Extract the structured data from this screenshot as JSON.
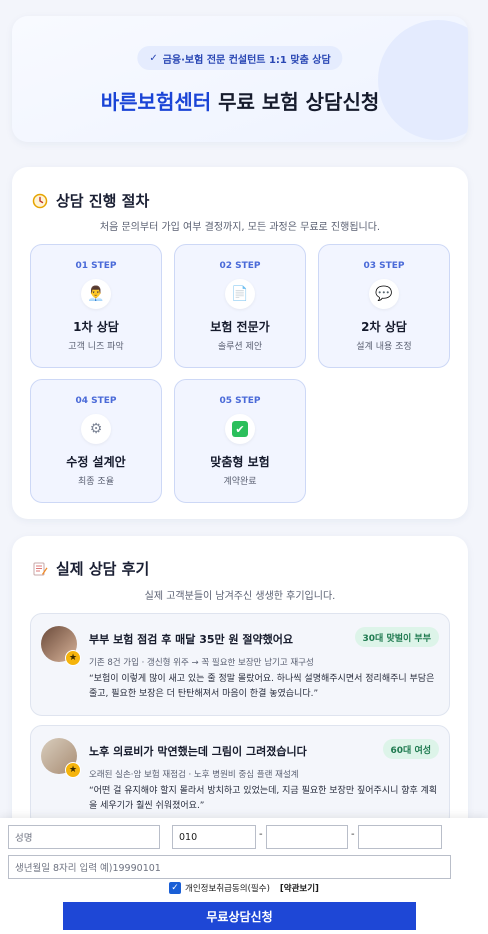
{
  "hero": {
    "badge_check": "✓",
    "badge": "금융·보험 전문 컨설턴트 1:1 맞춤 상담",
    "title_brand": "바른보험센터",
    "title_rest": " 무료 보험 상담신청"
  },
  "process": {
    "icon": "clock-icon",
    "title": "상담 진행 절차",
    "subtitle": "처음 문의부터 가입 여부 결정까지, 모든 과정은 무료로 진행됩니다.",
    "steps": [
      {
        "num": "01 STEP",
        "icon": "consultant-icon",
        "glyph": "👨‍💼",
        "name": "1차 상담",
        "desc": "고객 니즈 파악"
      },
      {
        "num": "02 STEP",
        "icon": "document-icon",
        "glyph": "📄",
        "name": "보험 전문가",
        "desc": "솔루션 제안"
      },
      {
        "num": "03 STEP",
        "icon": "speech-bubble-icon",
        "glyph": "💬",
        "name": "2차 상담",
        "desc": "설계 내용 조정"
      },
      {
        "num": "04 STEP",
        "icon": "gear-icon",
        "glyph": "⚙",
        "name": "수정 설계안",
        "desc": "최종 조율"
      },
      {
        "num": "05 STEP",
        "icon": "check-box-icon",
        "glyph": "✔",
        "name": "맞춤형 보험",
        "desc": "계약완료"
      }
    ]
  },
  "reviews": {
    "icon": "memo-icon",
    "title": "실제 상담 후기",
    "subtitle": "실제 고객분들이 남겨주신 생생한 후기입니다.",
    "items": [
      {
        "title": "부부 보험 점검 후 매달 35만 원 절약했어요",
        "tag": "30대 맞벌이 부부",
        "meta": "기존 8건 가입 · 갱신형 위주 → 꼭 필요한 보장만 남기고 재구성",
        "quote": "“보험이 이렇게 많이 새고 있는 줄 정말 몰랐어요. 하나씩 설명해주시면서 정리해주니 부담은 줄고, 필요한 보장은 더 탄탄해져서 마음이 한결 놓였습니다.”"
      },
      {
        "title": "노후 의료비가 막연했는데 그림이 그려졌습니다",
        "tag": "60대 여성",
        "meta": "오래된 실손·암 보험 재점검 · 노후 병원비 중심 플랜 재설계",
        "quote": "“어떤 걸 유지해야 할지 몰라서 방치하고 있었는데, 지금 필요한 보장만 짚어주시니 향후 계획을 세우기가 훨씬 쉬워졌어요.”"
      }
    ]
  },
  "form": {
    "name_placeholder": "성명",
    "phone_prefix": "010",
    "phone_mid": "",
    "phone_last": "",
    "birth_placeholder": "생년월일 8자리 입력 예)19990101",
    "dash": "-",
    "agree_check": "✓",
    "agree_label": "개인정보취급동의(필수)",
    "terms_label": "[약관보기]",
    "submit_label": "무료상담신청"
  },
  "colors": {
    "brand": "#1a44d6",
    "submit": "#1e47d6",
    "step_bg": "#f2f5ff",
    "tag_bg": "#ddf4e9"
  }
}
